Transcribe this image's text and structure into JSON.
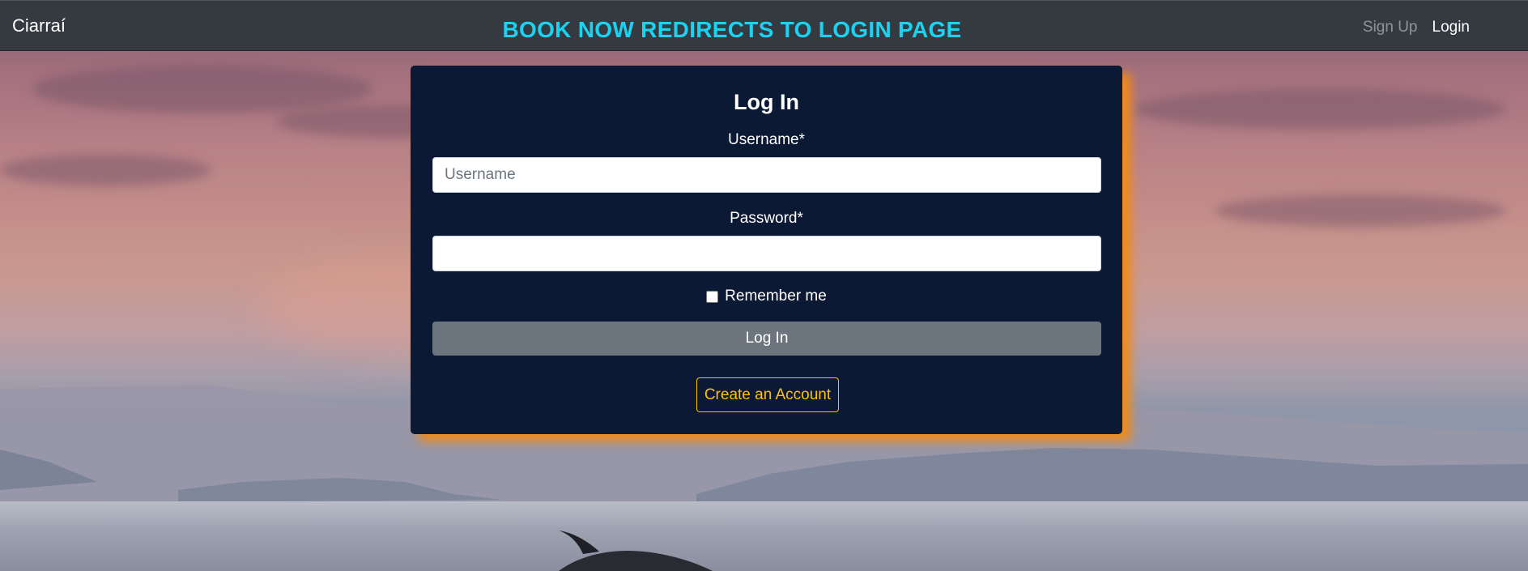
{
  "navbar": {
    "brand": "Ciarraí",
    "banner": "BOOK NOW REDIRECTS TO LOGIN PAGE",
    "links": [
      "Sign Up",
      "Login"
    ]
  },
  "login_form": {
    "title": "Log In",
    "username_label": "Username*",
    "username_placeholder": "Username",
    "username_value": "",
    "password_label": "Password*",
    "password_value": "",
    "remember_label": "Remember me",
    "remember_checked": false,
    "submit_label": "Log In",
    "create_account_label": "Create an Account"
  },
  "colors": {
    "navbar_bg": "#343a40",
    "banner_text": "#19d3f0",
    "card_bg": "#0b1935",
    "card_shadow": "#ef8a1b",
    "submit_bg": "#6c757d",
    "create_account_outline": "#ffc107"
  },
  "background": {
    "icon": "dolphin-seascape-image"
  }
}
